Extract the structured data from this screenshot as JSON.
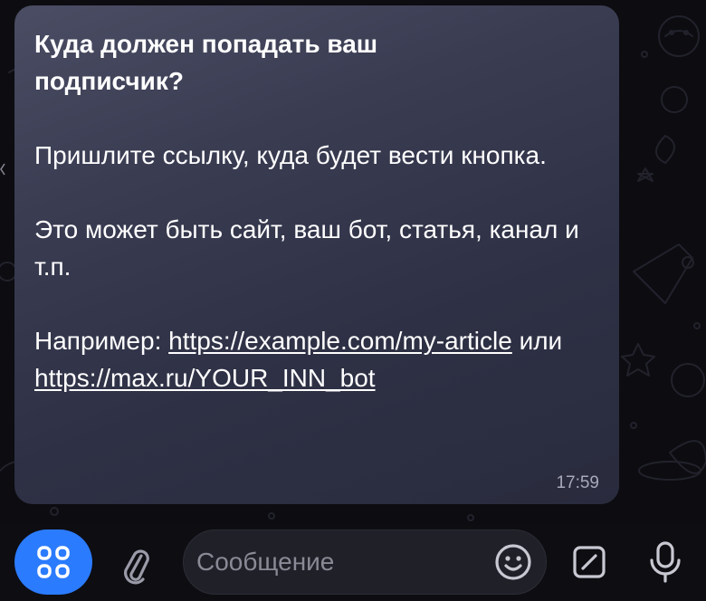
{
  "message": {
    "title": "Куда должен попадать ваш подписчик?",
    "paragraph_1": "Пришлите ссылку, куда будет вести кнопка.",
    "paragraph_2": "Это может быть сайт, ваш бот, статья, канал и т.п.",
    "paragraph_3_prefix": "Например: ",
    "link_1": "https://example.com/my-article",
    "separator": " или ",
    "link_2": "https://max.ru/YOUR_INN_bot",
    "time": "17:59"
  },
  "input_bar": {
    "placeholder": "Сообщение",
    "value": ""
  },
  "icons": {
    "apps": "apps-grid-icon",
    "attach": "paperclip-icon",
    "emoji": "smiley-icon",
    "sticker": "sticker-icon",
    "mic": "microphone-icon"
  },
  "colors": {
    "accent": "#2b7bff",
    "bubble": "#3a3c52",
    "background": "#0d0d12",
    "time_text": "#a8aabb"
  }
}
